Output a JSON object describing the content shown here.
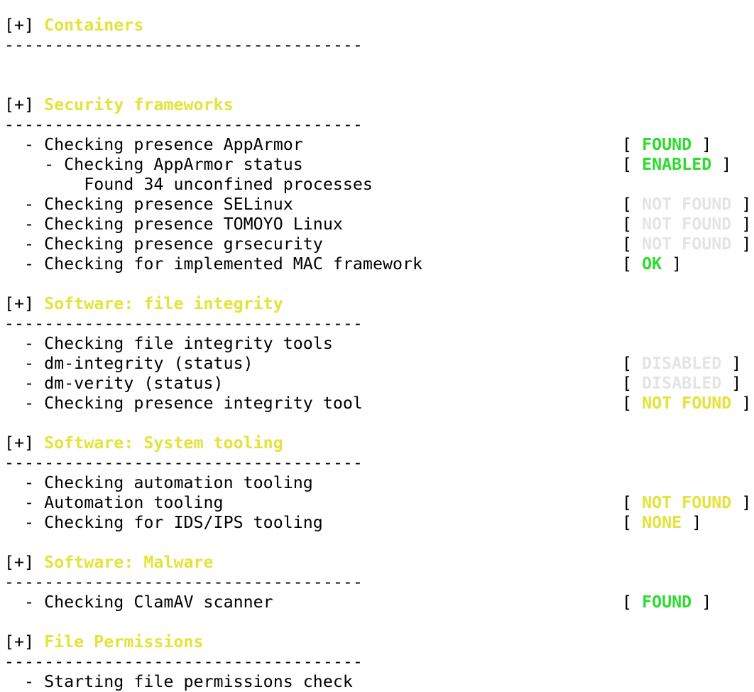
{
  "colors": {
    "heading": "#e3e33a",
    "green": "#2edc2e",
    "yellow": "#e3e33a",
    "grey": "#e4e4e4",
    "text": "#000000",
    "background": "#ffffff"
  },
  "lines": [
    {
      "kind": "heading",
      "prefix": "[+] ",
      "text": "Containers"
    },
    {
      "kind": "separator",
      "text": "------------------------------------"
    },
    {
      "kind": "blank"
    },
    {
      "kind": "blank"
    },
    {
      "kind": "heading",
      "prefix": "[+] ",
      "text": "Security frameworks"
    },
    {
      "kind": "separator",
      "text": "------------------------------------"
    },
    {
      "kind": "check",
      "text": "  - Checking presence AppArmor",
      "status": "FOUND",
      "color": "green"
    },
    {
      "kind": "check",
      "text": "    - Checking AppArmor status",
      "status": "ENABLED",
      "color": "green"
    },
    {
      "kind": "text",
      "text": "        Found 34 unconfined processes"
    },
    {
      "kind": "check",
      "text": "  - Checking presence SELinux",
      "status": "NOT FOUND",
      "color": "grey"
    },
    {
      "kind": "check",
      "text": "  - Checking presence TOMOYO Linux",
      "status": "NOT FOUND",
      "color": "grey"
    },
    {
      "kind": "check",
      "text": "  - Checking presence grsecurity",
      "status": "NOT FOUND",
      "color": "grey"
    },
    {
      "kind": "check",
      "text": "  - Checking for implemented MAC framework",
      "status": "OK",
      "color": "green"
    },
    {
      "kind": "blank"
    },
    {
      "kind": "heading",
      "prefix": "[+] ",
      "text": "Software: file integrity"
    },
    {
      "kind": "separator",
      "text": "------------------------------------"
    },
    {
      "kind": "text",
      "text": "  - Checking file integrity tools"
    },
    {
      "kind": "check",
      "text": "  - dm-integrity (status)",
      "status": "DISABLED",
      "color": "grey"
    },
    {
      "kind": "check",
      "text": "  - dm-verity (status)",
      "status": "DISABLED",
      "color": "grey"
    },
    {
      "kind": "check",
      "text": "  - Checking presence integrity tool",
      "status": "NOT FOUND",
      "color": "yellow"
    },
    {
      "kind": "blank"
    },
    {
      "kind": "heading",
      "prefix": "[+] ",
      "text": "Software: System tooling"
    },
    {
      "kind": "separator",
      "text": "------------------------------------"
    },
    {
      "kind": "text",
      "text": "  - Checking automation tooling"
    },
    {
      "kind": "check",
      "text": "  - Automation tooling",
      "status": "NOT FOUND",
      "color": "yellow"
    },
    {
      "kind": "check",
      "text": "  - Checking for IDS/IPS tooling",
      "status": "NONE",
      "color": "yellow"
    },
    {
      "kind": "blank"
    },
    {
      "kind": "heading",
      "prefix": "[+] ",
      "text": "Software: Malware"
    },
    {
      "kind": "separator",
      "text": "------------------------------------"
    },
    {
      "kind": "check",
      "text": "  - Checking ClamAV scanner",
      "status": "FOUND",
      "color": "green"
    },
    {
      "kind": "blank"
    },
    {
      "kind": "heading",
      "prefix": "[+] ",
      "text": "File Permissions"
    },
    {
      "kind": "separator",
      "text": "------------------------------------"
    },
    {
      "kind": "text",
      "text": "  - Starting file permissions check"
    }
  ]
}
